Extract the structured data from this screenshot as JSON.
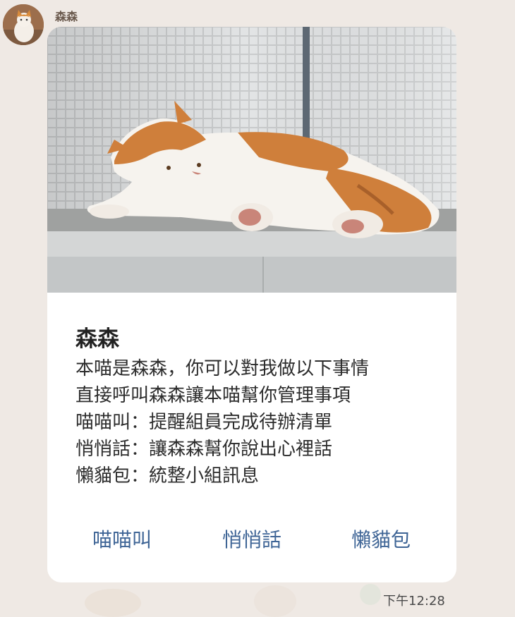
{
  "header": {
    "sender_name": "森森"
  },
  "card": {
    "title": "森森",
    "body_lines": [
      "本喵是森森，你可以對我做以下事情",
      "直接呼叫森森讓本喵幫你管理事項",
      "喵喵叫：提醒組員完成待辦清單",
      "悄悄話：讓森森幫你說出心裡話",
      "懶貓包：統整小組訊息"
    ],
    "actions": [
      "喵喵叫",
      "悄悄話",
      "懶貓包"
    ]
  },
  "message": {
    "timestamp": "下午12:28"
  },
  "colors": {
    "action_link": "#3f6596",
    "background": "#efe9e4",
    "card": "#ffffff"
  }
}
